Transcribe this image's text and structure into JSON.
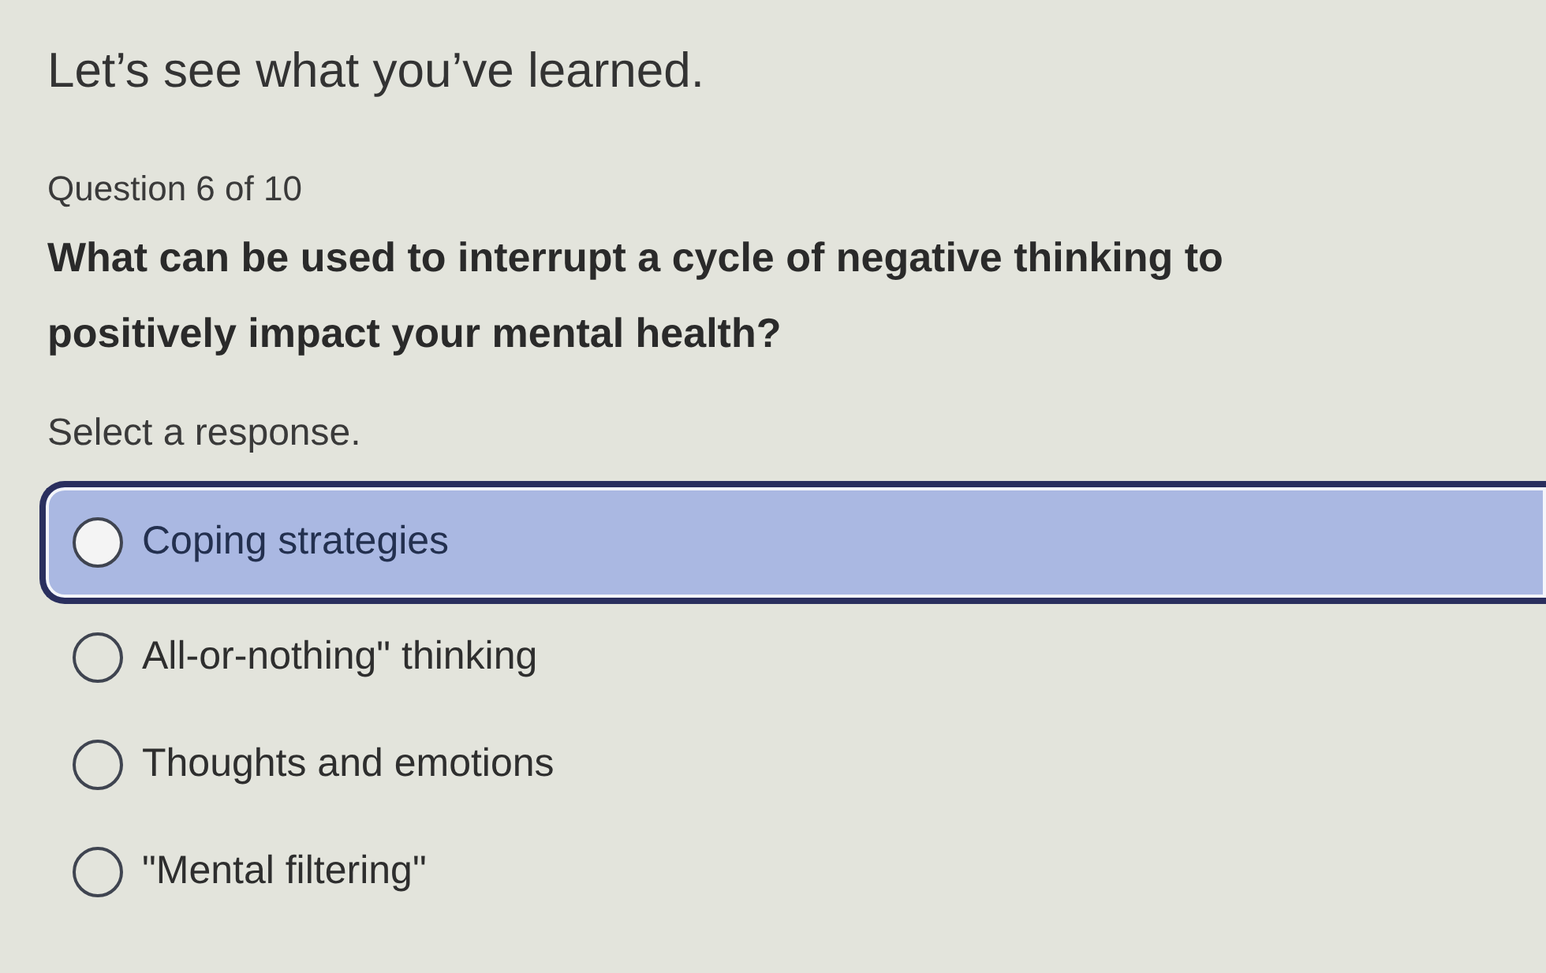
{
  "heading": "Let’s see what you’ve learned.",
  "progress": "Question 6 of 10",
  "question": "What can be used to interrupt a cycle of negative thinking to positively impact your mental health?",
  "instruction": "Select a response.",
  "options": [
    {
      "label": "Coping strategies",
      "selected": false,
      "highlighted": true
    },
    {
      "label": "All-or-nothing\" thinking",
      "selected": false,
      "highlighted": false
    },
    {
      "label": "Thoughts and emotions",
      "selected": false,
      "highlighted": false
    },
    {
      "label": "\"Mental filtering\"",
      "selected": false,
      "highlighted": false
    }
  ]
}
